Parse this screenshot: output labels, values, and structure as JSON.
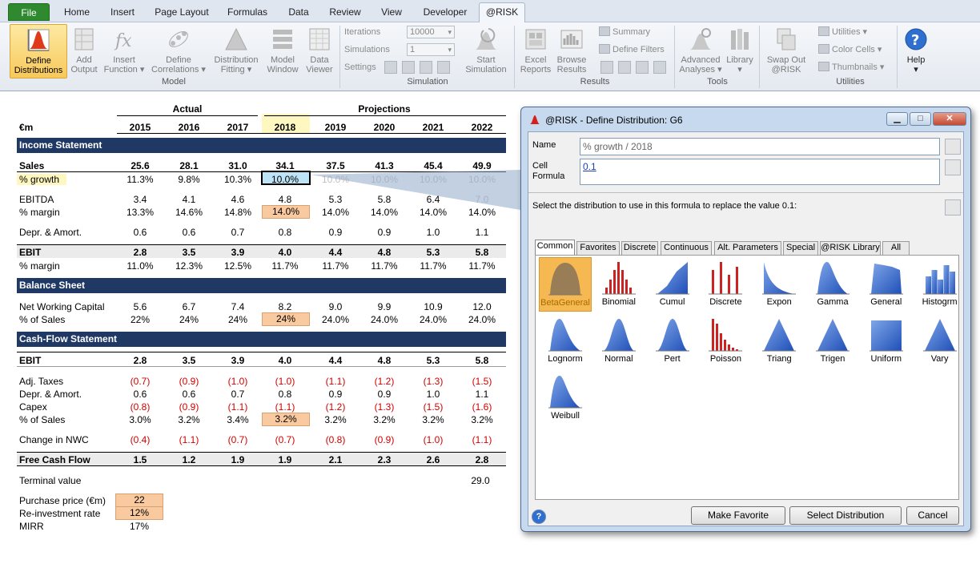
{
  "ribbon": {
    "tabs": [
      "File",
      "Home",
      "Insert",
      "Page Layout",
      "Formulas",
      "Data",
      "Review",
      "View",
      "Developer",
      "@RISK"
    ],
    "model_buttons": [
      {
        "l1": "Define",
        "l2": "Distributions"
      },
      {
        "l1": "Add",
        "l2": "Output"
      },
      {
        "l1": "Insert",
        "l2": "Function ▾"
      },
      {
        "l1": "Define",
        "l2": "Correlations ▾"
      },
      {
        "l1": "Distribution",
        "l2": "Fitting ▾"
      },
      {
        "l1": "Model",
        "l2": "Window"
      },
      {
        "l1": "Data",
        "l2": "Viewer"
      }
    ],
    "groups": {
      "model": "Model",
      "simulation": "Simulation",
      "results": "Results",
      "tools": "Tools",
      "utilities": "Utilities"
    },
    "iterations_label": "Iterations",
    "iterations_value": "10000",
    "simulations_label": "Simulations",
    "simulations_value": "1",
    "settings_label": "Settings",
    "start_sim": {
      "l1": "Start",
      "l2": "Simulation"
    },
    "excel_reports": {
      "l1": "Excel",
      "l2": "Reports"
    },
    "browse_results": {
      "l1": "Browse",
      "l2": "Results"
    },
    "summary": "Summary",
    "define_filters": "Define Filters",
    "advanced": {
      "l1": "Advanced",
      "l2": "Analyses ▾"
    },
    "library": {
      "l1": "Library",
      "l2": "▾"
    },
    "swap_out": {
      "l1": "Swap Out",
      "l2": "@RISK"
    },
    "utilities": "Utilities ▾",
    "color_cells": "Color Cells ▾",
    "thumbnails": "Thumbnails ▾",
    "help": {
      "l1": "Help",
      "l2": "▾"
    }
  },
  "sheet": {
    "actual_label": "Actual",
    "projections_label": "Projections",
    "unit": "€m",
    "years": [
      "2015",
      "2016",
      "2017",
      "2018",
      "2019",
      "2020",
      "2021",
      "2022"
    ],
    "sections": {
      "income": "Income Statement",
      "balance": "Balance Sheet",
      "cashflow": "Cash-Flow Statement"
    },
    "rows": {
      "sales": {
        "label": "Sales",
        "v": [
          "25.6",
          "28.1",
          "31.0",
          "34.1",
          "37.5",
          "41.3",
          "45.4",
          "49.9"
        ]
      },
      "growth": {
        "label": "% growth",
        "v": [
          "11.3%",
          "9.8%",
          "10.3%",
          "10.0%",
          "10.0%",
          "10.0%",
          "10.0%",
          "10.0%"
        ]
      },
      "ebitda": {
        "label": "EBITDA",
        "v": [
          "3.4",
          "4.1",
          "4.6",
          "4.8",
          "5.3",
          "5.8",
          "6.4",
          "7.0"
        ]
      },
      "margin1": {
        "label": "% margin",
        "v": [
          "13.3%",
          "14.6%",
          "14.8%",
          "14.0%",
          "14.0%",
          "14.0%",
          "14.0%",
          "14.0%"
        ]
      },
      "depr": {
        "label": "Depr. & Amort.",
        "v": [
          "0.6",
          "0.6",
          "0.7",
          "0.8",
          "0.9",
          "0.9",
          "1.0",
          "1.1"
        ]
      },
      "ebit": {
        "label": "EBIT",
        "v": [
          "2.8",
          "3.5",
          "3.9",
          "4.0",
          "4.4",
          "4.8",
          "5.3",
          "5.8"
        ]
      },
      "margin2": {
        "label": "% margin",
        "v": [
          "11.0%",
          "12.3%",
          "12.5%",
          "11.7%",
          "11.7%",
          "11.7%",
          "11.7%",
          "11.7%"
        ]
      },
      "nwc": {
        "label": "Net Working Capital",
        "v": [
          "5.6",
          "6.7",
          "7.4",
          "8.2",
          "9.0",
          "9.9",
          "10.9",
          "12.0"
        ]
      },
      "nwc_pct": {
        "label": "% of Sales",
        "v": [
          "22%",
          "24%",
          "24%",
          "24%",
          "24.0%",
          "24.0%",
          "24.0%",
          "24.0%"
        ]
      },
      "cf_ebit": {
        "label": "EBIT",
        "v": [
          "2.8",
          "3.5",
          "3.9",
          "4.0",
          "4.4",
          "4.8",
          "5.3",
          "5.8"
        ]
      },
      "taxes": {
        "label": "Adj. Taxes",
        "v": [
          "(0.7)",
          "(0.9)",
          "(1.0)",
          "(1.0)",
          "(1.1)",
          "(1.2)",
          "(1.3)",
          "(1.5)"
        ]
      },
      "cf_depr": {
        "label": "Depr. & Amort.",
        "v": [
          "0.6",
          "0.6",
          "0.7",
          "0.8",
          "0.9",
          "0.9",
          "1.0",
          "1.1"
        ]
      },
      "capex": {
        "label": "Capex",
        "v": [
          "(0.8)",
          "(0.9)",
          "(1.1)",
          "(1.1)",
          "(1.2)",
          "(1.3)",
          "(1.5)",
          "(1.6)"
        ]
      },
      "capex_pct": {
        "label": "% of Sales",
        "v": [
          "3.0%",
          "3.2%",
          "3.4%",
          "3.2%",
          "3.2%",
          "3.2%",
          "3.2%",
          "3.2%"
        ]
      },
      "chg_nwc": {
        "label": "Change in NWC",
        "v": [
          "(0.4)",
          "(1.1)",
          "(0.7)",
          "(0.7)",
          "(0.8)",
          "(0.9)",
          "(1.0)",
          "(1.1)"
        ]
      },
      "fcf": {
        "label": "Free Cash Flow",
        "v": [
          "1.5",
          "1.2",
          "1.9",
          "1.9",
          "2.1",
          "2.3",
          "2.6",
          "2.8"
        ]
      }
    },
    "terminal_label": "Terminal value",
    "terminal_value": "29.0",
    "purchase_label": "Purchase price (€m)",
    "purchase_value": "22",
    "reinvest_label": "Re-investment rate",
    "reinvest_value": "12%",
    "mirr_label": "MIRR",
    "mirr_value": "17%"
  },
  "dialog": {
    "title": "@RISK - Define Distribution: G6",
    "name_label": "Name",
    "name_value": "% growth / 2018",
    "formula_label_1": "Cell",
    "formula_label_2": "Formula",
    "formula_value": "0.1",
    "instruction": "Select the distribution to use in this formula to replace the value 0.1:",
    "tabs": [
      "Common",
      "Favorites",
      "Discrete",
      "Continuous",
      "Alt. Parameters",
      "Special",
      "@RISK Library",
      "All"
    ],
    "distributions": [
      "BetaGeneral",
      "Binomial",
      "Cumul",
      "Discrete",
      "Expon",
      "Gamma",
      "General",
      "Histogrm",
      "Lognorm",
      "Normal",
      "Pert",
      "Poisson",
      "Triang",
      "Trigen",
      "Uniform",
      "Vary",
      "Weibull"
    ],
    "buttons": {
      "favorite": "Make Favorite",
      "select": "Select Distribution",
      "cancel": "Cancel"
    },
    "colors": {
      "accent": "#f6b951",
      "dist_blue": "#1f4fb8",
      "dist_red": "#cc2222"
    }
  }
}
